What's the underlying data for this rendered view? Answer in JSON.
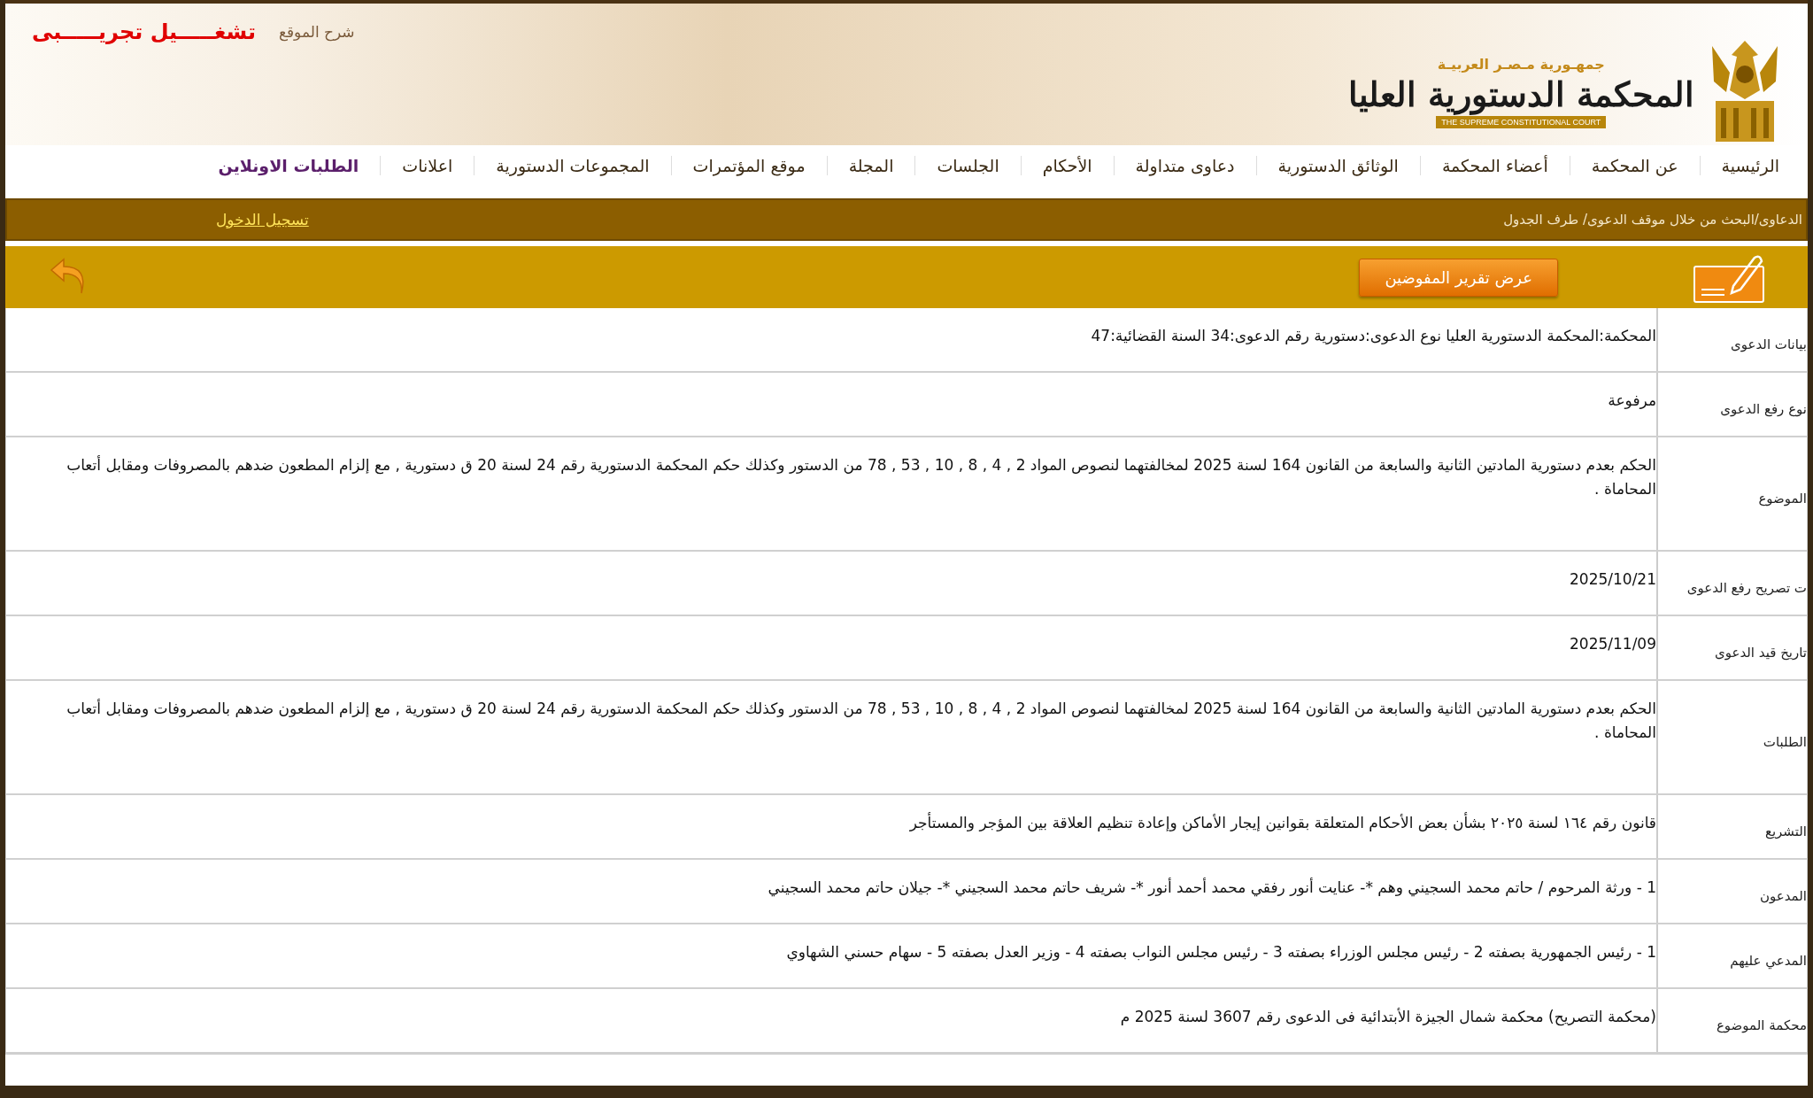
{
  "header": {
    "country": "جمهـورية مـصـر العربيـة",
    "court_name": "المحكمة الدستورية العليا",
    "court_name_en": "THE SUPREME CONSTITUTIONAL COURT",
    "guide_link": "شرح الموقع",
    "trial_notice": "تشغـــــيل تجريـــــبى"
  },
  "nav": [
    {
      "label": "الرئيسية",
      "selected": false
    },
    {
      "label": "عن المحكمة",
      "selected": false
    },
    {
      "label": "أعضاء المحكمة",
      "selected": false
    },
    {
      "label": "الوثائق الدستورية",
      "selected": false
    },
    {
      "label": "دعاوى متداولة",
      "selected": false
    },
    {
      "label": "الأحكام",
      "selected": false
    },
    {
      "label": "الجلسات",
      "selected": false
    },
    {
      "label": "المجلة",
      "selected": false
    },
    {
      "label": "موقع المؤتمرات",
      "selected": false
    },
    {
      "label": "المجموعات الدستورية",
      "selected": false
    },
    {
      "label": "اعلانات",
      "selected": false
    },
    {
      "label": "الطلبات الاونلاين",
      "selected": true
    }
  ],
  "breadcrumb": "الدعاوى/البحث من خلال موقف الدعوى/ طرف الجدول",
  "login": "تسجيل الدخول",
  "toolbar": {
    "report_button": "عرض تقرير المفوضين"
  },
  "rows": [
    {
      "label": "بيانات الدعوى",
      "value": "المحكمة:المحكمة الدستورية العليا نوع الدعوى:دستورية رقم الدعوى:34 السنة القضائية:47"
    },
    {
      "label": "نوع رفع الدعوى",
      "value": "مرفوعة"
    },
    {
      "label": "الموضوع",
      "value": "الحكم بعدم دستورية المادتين الثانية والسابعة من القانون 164 لسنة 2025 لمخالفتهما لنصوص المواد 2 , 4 , 8 , 10 , 53 , 78 من الدستور وكذلك حكم المحكمة الدستورية رقم 24 لسنة 20 ق دستورية , مع إلزام المطعون ضدهم بالمصروفات ومقابل أتعاب المحاماة ."
    },
    {
      "label": "ت تصريح رفع الدعوى",
      "value": "2025/10/21"
    },
    {
      "label": "تاريخ قيد الدعوى",
      "value": "2025/11/09"
    },
    {
      "label": "الطلبات",
      "value": "الحكم بعدم دستورية المادتين الثانية والسابعة من القانون 164 لسنة 2025 لمخالفتهما لنصوص المواد 2 , 4 , 8 , 10 , 53 , 78 من الدستور وكذلك حكم المحكمة الدستورية رقم 24 لسنة 20 ق دستورية , مع إلزام المطعون ضدهم بالمصروفات ومقابل أتعاب المحاماة ."
    },
    {
      "label": "التشريع",
      "value": "قانون رقم ١٦٤ لسنة ٢٠٢٥ بشأن بعض الأحكام المتعلقة بقوانين إيجار الأماكن وإعادة تنظيم العلاقة بين المؤجر والمستأجر"
    },
    {
      "label": "المدعون",
      "value": "1 - ورثة المرحوم / حاتم محمد السجيني وهم *- عنايت أنور رفقي محمد أحمد أنور *- شريف حاتم محمد السجيني *- جيلان حاتم محمد السجيني"
    },
    {
      "label": "المدعي عليهم",
      "value": "1 - رئيس الجمهورية بصفته 2 - رئيس مجلس الوزراء بصفته 3 - رئيس مجلس النواب بصفته 4 - وزير العدل بصفته 5 - سهام حسني الشهاوي"
    },
    {
      "label": "محكمة الموضوع",
      "value": "(محكمة التصريح) محكمة شمال الجيزة الأبتدائية فى الدعوى رقم 3607 لسنة 2025 م"
    }
  ]
}
